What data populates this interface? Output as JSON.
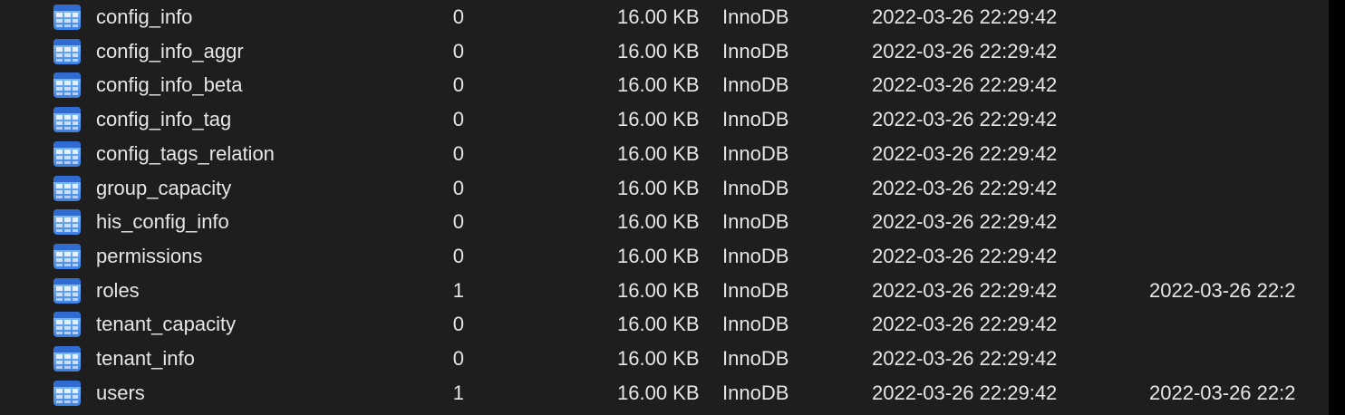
{
  "tables": [
    {
      "name": "config_info",
      "rows": "0",
      "size": "16.00 KB",
      "engine": "InnoDB",
      "created": "2022-03-26 22:29:42",
      "updated": ""
    },
    {
      "name": "config_info_aggr",
      "rows": "0",
      "size": "16.00 KB",
      "engine": "InnoDB",
      "created": "2022-03-26 22:29:42",
      "updated": ""
    },
    {
      "name": "config_info_beta",
      "rows": "0",
      "size": "16.00 KB",
      "engine": "InnoDB",
      "created": "2022-03-26 22:29:42",
      "updated": ""
    },
    {
      "name": "config_info_tag",
      "rows": "0",
      "size": "16.00 KB",
      "engine": "InnoDB",
      "created": "2022-03-26 22:29:42",
      "updated": ""
    },
    {
      "name": "config_tags_relation",
      "rows": "0",
      "size": "16.00 KB",
      "engine": "InnoDB",
      "created": "2022-03-26 22:29:42",
      "updated": ""
    },
    {
      "name": "group_capacity",
      "rows": "0",
      "size": "16.00 KB",
      "engine": "InnoDB",
      "created": "2022-03-26 22:29:42",
      "updated": ""
    },
    {
      "name": "his_config_info",
      "rows": "0",
      "size": "16.00 KB",
      "engine": "InnoDB",
      "created": "2022-03-26 22:29:42",
      "updated": ""
    },
    {
      "name": "permissions",
      "rows": "0",
      "size": "16.00 KB",
      "engine": "InnoDB",
      "created": "2022-03-26 22:29:42",
      "updated": ""
    },
    {
      "name": "roles",
      "rows": "1",
      "size": "16.00 KB",
      "engine": "InnoDB",
      "created": "2022-03-26 22:29:42",
      "updated": "2022-03-26 22:2"
    },
    {
      "name": "tenant_capacity",
      "rows": "0",
      "size": "16.00 KB",
      "engine": "InnoDB",
      "created": "2022-03-26 22:29:42",
      "updated": ""
    },
    {
      "name": "tenant_info",
      "rows": "0",
      "size": "16.00 KB",
      "engine": "InnoDB",
      "created": "2022-03-26 22:29:42",
      "updated": ""
    },
    {
      "name": "users",
      "rows": "1",
      "size": "16.00 KB",
      "engine": "InnoDB",
      "created": "2022-03-26 22:29:42",
      "updated": "2022-03-26 22:2"
    }
  ],
  "icon": "table-icon",
  "colors": {
    "background": "#1e1e1e",
    "text": "#e6e6e6",
    "icon_blue": "#4a8fe6"
  }
}
